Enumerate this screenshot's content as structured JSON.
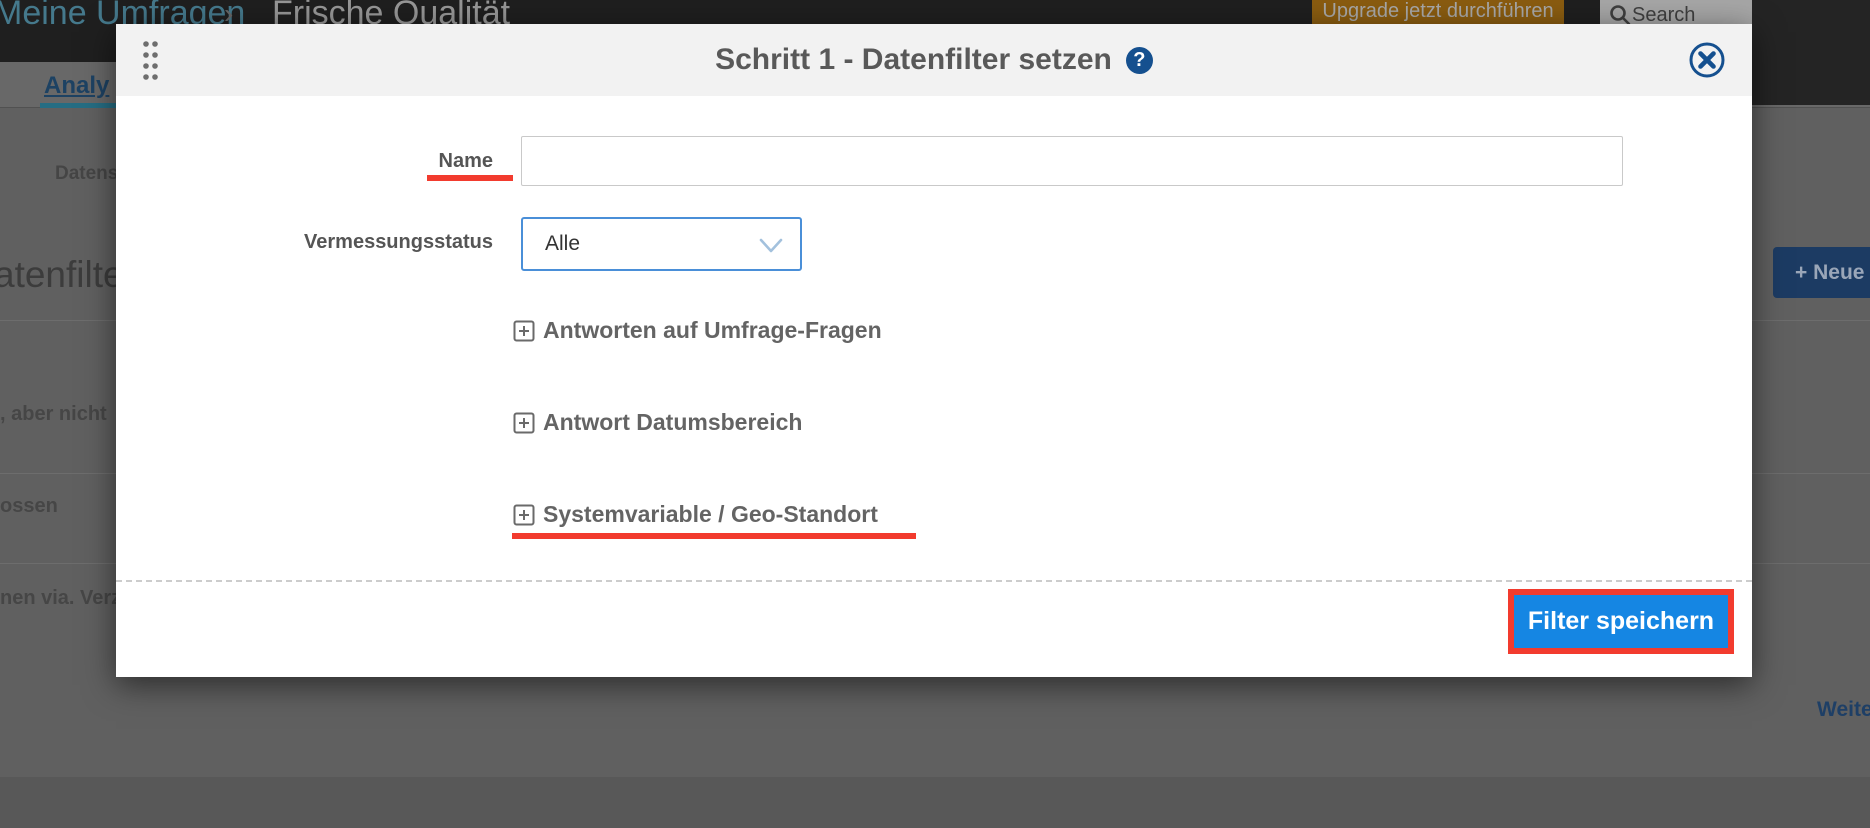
{
  "page": {
    "topbar": {
      "breadcrumb_home": "Meine Umfragen",
      "breadcrumb_separator": "›",
      "breadcrumb_current": "Frische Qualität",
      "upgrade_button": "Upgrade jetzt durchführen",
      "search_placeholder": "Search"
    },
    "tabs": {
      "active_tab": "Analy"
    },
    "background": {
      "datens_label": "Datens",
      "heading": "atenfilter",
      "rows": [
        ", aber nicht",
        "ossen",
        "nen via. Verz"
      ],
      "new_button": "+ Neue",
      "weiter_link": "Weite"
    }
  },
  "modal": {
    "title": "Schritt 1 - Datenfilter setzen",
    "help_icon": "?",
    "fields": {
      "name_label": "Name",
      "name_value": "",
      "status_label": "Vermessungsstatus",
      "status_value": "Alle"
    },
    "sections": [
      {
        "label": "Antworten auf Umfrage-Fragen"
      },
      {
        "label": "Antwort Datumsbereich"
      },
      {
        "label": "Systemvariable / Geo-Standort"
      }
    ],
    "save_button": "Filter speichern"
  },
  "colors": {
    "annotation_red": "#f23b2e",
    "primary_blue": "#1586e3",
    "navy_icon": "#15508f",
    "dropdown_border": "#4a8fd8",
    "upgrade_orange": "#8a5c10",
    "link_teal": "#45798c"
  }
}
